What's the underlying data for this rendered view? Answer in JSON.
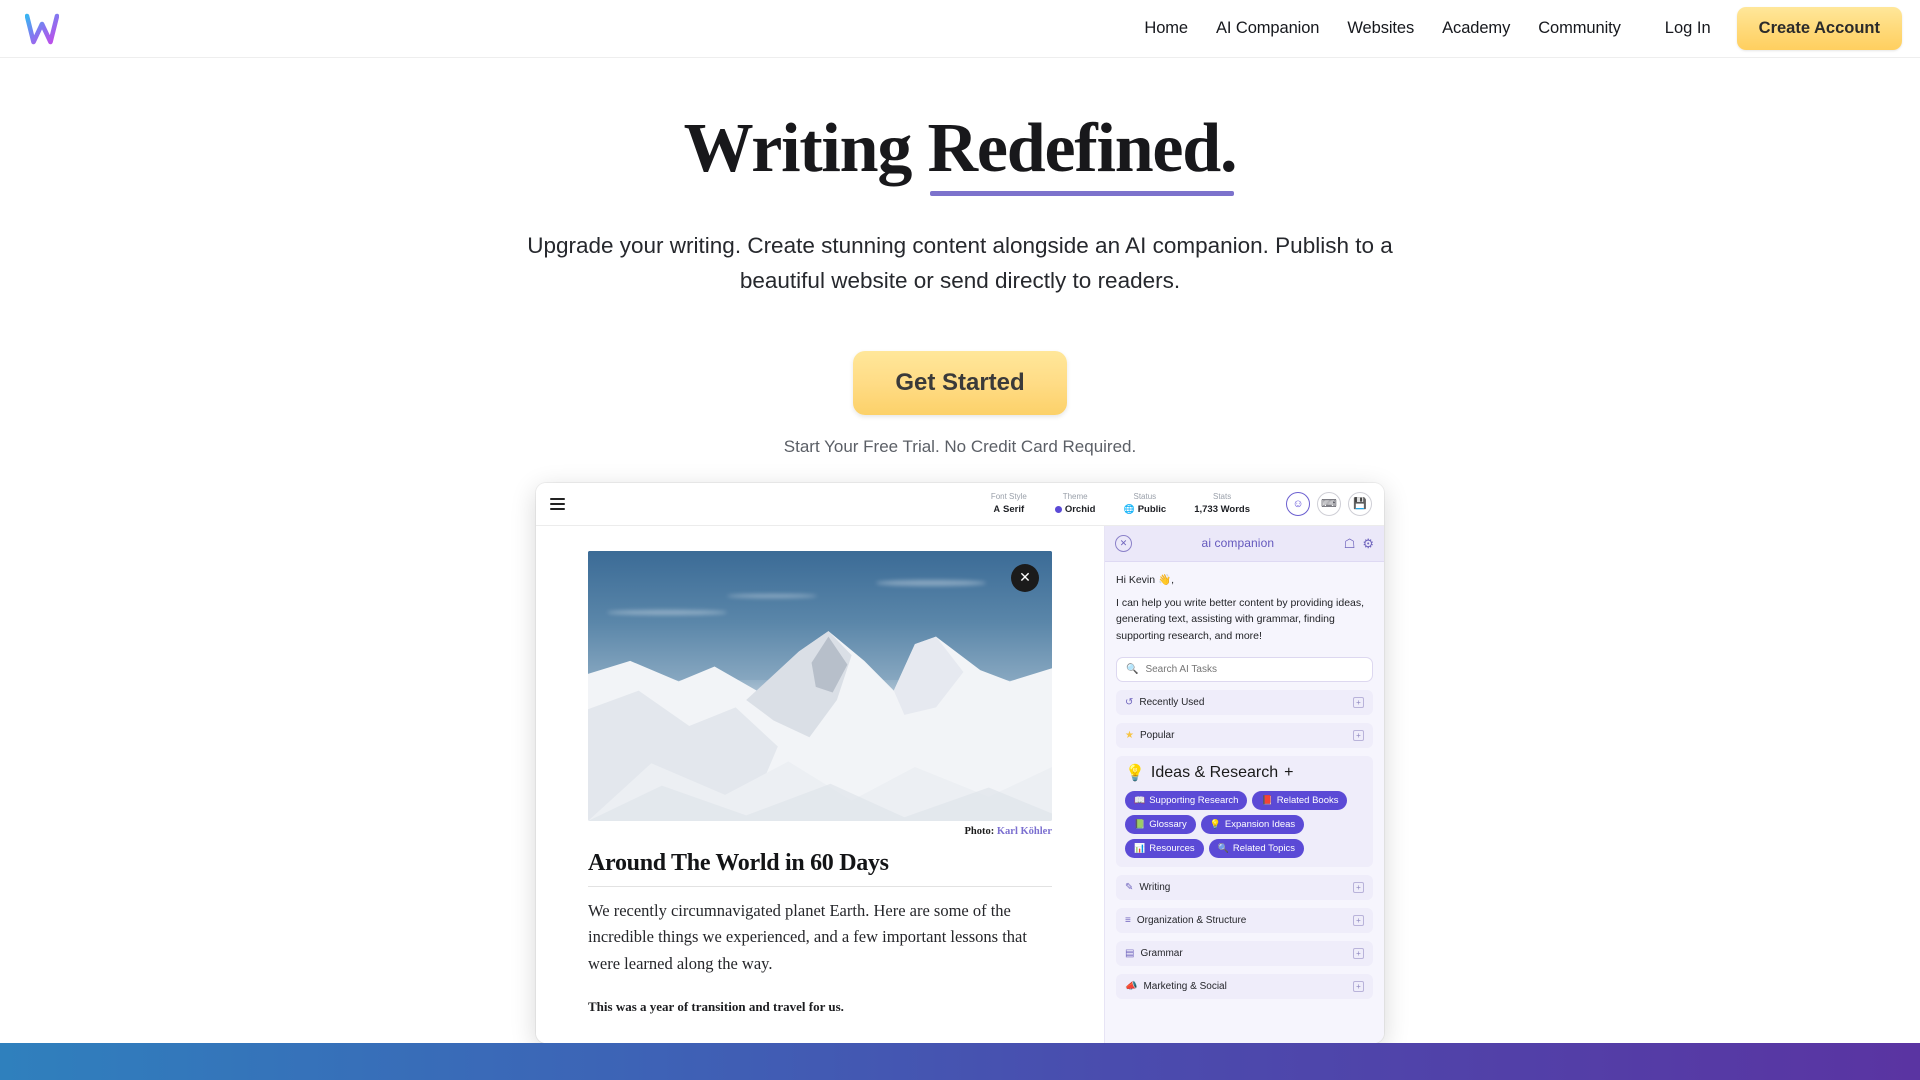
{
  "nav": {
    "logo_name": "w-logo",
    "links": [
      {
        "label": "Home",
        "name": "nav-link-home"
      },
      {
        "label": "AI Companion",
        "name": "nav-link-ai-companion"
      },
      {
        "label": "Websites",
        "name": "nav-link-websites"
      },
      {
        "label": "Academy",
        "name": "nav-link-academy"
      },
      {
        "label": "Community",
        "name": "nav-link-community"
      }
    ],
    "login_label": "Log In",
    "create_account_label": "Create Account"
  },
  "hero": {
    "heading_part1": "Writing ",
    "heading_part2": "Redefined.",
    "subheading": "Upgrade your writing. Create stunning content alongside an AI companion. Publish to a beautiful website or send directly to readers.",
    "cta_label": "Get Started",
    "trial_note": "Start Your Free Trial. No Credit Card Required.",
    "accent_underline_color": "#7c72cc"
  },
  "app": {
    "toolbar": {
      "menu_icon": "hamburger-menu-icon",
      "stats": [
        {
          "label": "Font Style",
          "value": "Serif",
          "glyph": "A",
          "name": "font-style-stat"
        },
        {
          "label": "Theme",
          "value": "Orchid",
          "glyph": "dot",
          "name": "theme-stat"
        },
        {
          "label": "Status",
          "value": "Public",
          "glyph": "ἱ0",
          "name": "status-stat"
        },
        {
          "label": "Stats",
          "value": "1,733 Words",
          "glyph": "",
          "name": "word-count-stat"
        }
      ],
      "icons": [
        {
          "name": "smiley-icon",
          "glyph": "☺",
          "active": true
        },
        {
          "name": "keyboard-icon",
          "glyph": "⌨",
          "active": false
        },
        {
          "name": "save-disk-icon",
          "glyph": "ὋE",
          "active": false
        }
      ]
    },
    "document": {
      "close_label": "✕",
      "photo_credit_prefix": "Photo:",
      "photo_credit_name": "Karl Köhler",
      "title": "Around The World in 60 Days",
      "paragraph1": "We recently circumnavigated planet Earth. Here are some of the incredible things we experienced, and a few important lessons that were learned along the way.",
      "paragraph2": "This was a year of transition and travel for us."
    },
    "ai_panel": {
      "close_label": "✕",
      "title": "ai companion",
      "header_icons": [
        {
          "name": "bookmark-icon",
          "glyph": "ὑ6"
        },
        {
          "name": "gear-icon",
          "glyph": "⚙"
        }
      ],
      "greeting": "Hi Kevin 👋,",
      "intro": "I can help you write better content by providing ideas, generating text, assisting with grammar, finding supporting research, and more!",
      "search_placeholder": "Search AI Tasks",
      "search_value": "",
      "categories": [
        {
          "label": "Recently Used",
          "icon": "history-icon",
          "glyph": "↺",
          "color": "#6f64bd",
          "expanded": false
        },
        {
          "label": "Popular",
          "icon": "star-icon",
          "glyph": "★",
          "color": "#f6c445",
          "expanded": false
        },
        {
          "label": "Ideas & Research",
          "icon": "lightbulb-icon",
          "glyph": "Ὂ1",
          "color": "#6f64bd",
          "expanded": true,
          "chips": [
            {
              "label": "Supporting Research",
              "icon": "open-book-icon",
              "glyph": "Ὅ6"
            },
            {
              "label": "Related Books",
              "icon": "book-icon",
              "glyph": "Ὅ5"
            },
            {
              "label": "Glossary",
              "icon": "glossary-icon",
              "glyph": "Ὅ7"
            },
            {
              "label": "Expansion Ideas",
              "icon": "lightbulb-icon",
              "glyph": "Ὂ1"
            },
            {
              "label": "Resources",
              "icon": "chart-bars-icon",
              "glyph": "ὌA"
            },
            {
              "label": "Related Topics",
              "icon": "search-icon",
              "glyph": "ὐD"
            }
          ]
        },
        {
          "label": "Writing",
          "icon": "pencil-icon",
          "glyph": "✎",
          "color": "#6f64bd",
          "expanded": false
        },
        {
          "label": "Organization & Structure",
          "icon": "list-icon",
          "glyph": "≡",
          "color": "#6f64bd",
          "expanded": false
        },
        {
          "label": "Grammar",
          "icon": "grammar-icon",
          "glyph": "▤",
          "color": "#6f64bd",
          "expanded": false
        },
        {
          "label": "Marketing & Social",
          "icon": "megaphone-icon",
          "glyph": "὎3",
          "color": "#6f64bd",
          "expanded": false
        }
      ],
      "expand_glyph": "+",
      "accent_color": "#5b4ad6",
      "panel_bg": "#f6f5fd"
    }
  },
  "footer": {
    "gradient_from": "#2f80bd",
    "gradient_to": "#5a34a2"
  }
}
